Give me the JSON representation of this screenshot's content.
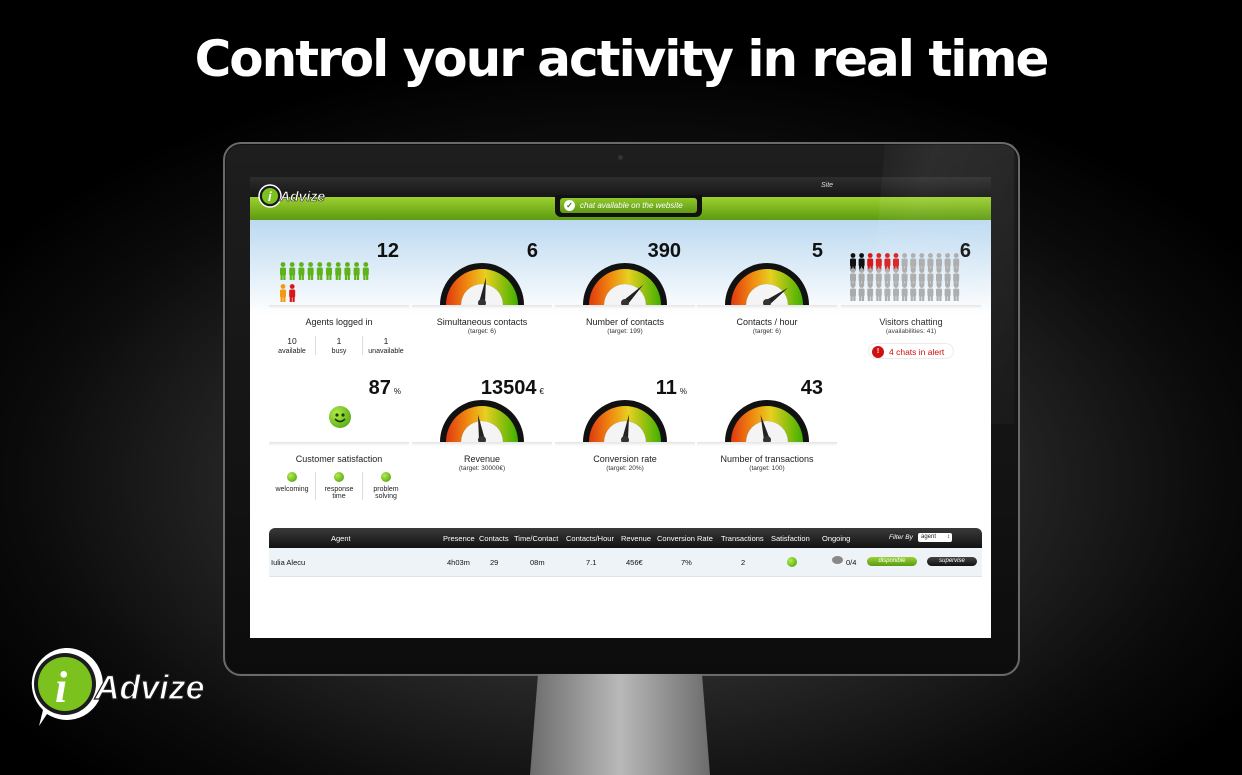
{
  "headline": "Control your activity in real time",
  "brand": {
    "name": "iAdvize",
    "green": "#7cc21e",
    "dark": "#1a1a1a"
  },
  "app": {
    "header_site_label": "Site",
    "chat_status": "chat available on the website"
  },
  "widgets_row1": [
    {
      "id": "agents",
      "value": "12",
      "title": "Agents logged in",
      "stats": [
        {
          "n": "10",
          "label": "available"
        },
        {
          "n": "1",
          "label": "busy"
        },
        {
          "n": "1",
          "label": "unavailable"
        }
      ]
    },
    {
      "id": "simultaneous",
      "value": "6",
      "title": "Simultaneous contacts",
      "sub": "(target: 6)",
      "level": 0.55
    },
    {
      "id": "contacts",
      "value": "390",
      "title": "Number of contacts",
      "sub": "(target: 199)",
      "level": 0.75
    },
    {
      "id": "per_hour",
      "value": "5",
      "title": "Contacts / hour",
      "sub": "(target: 6)",
      "level": 0.8
    },
    {
      "id": "visitors",
      "value": "6",
      "title": "Visitors chatting",
      "sub": "(availabilities: 41)",
      "alert": "4 chats in alert"
    }
  ],
  "widgets_row2": [
    {
      "id": "satisfaction",
      "value": "87",
      "unit": "%",
      "title": "Customer satisfaction",
      "stats": [
        {
          "label": "welcoming"
        },
        {
          "label": "response time"
        },
        {
          "label": "problem solving"
        }
      ]
    },
    {
      "id": "revenue",
      "value": "13504",
      "unit": "€",
      "title": "Revenue",
      "sub": "(target: 30000€)",
      "level": 0.45
    },
    {
      "id": "conversion",
      "value": "11",
      "unit": "%",
      "title": "Conversion rate",
      "sub": "(target: 20%)",
      "level": 0.55
    },
    {
      "id": "transactions",
      "value": "43",
      "title": "Number of transactions",
      "sub": "(target: 100)",
      "level": 0.42
    }
  ],
  "table": {
    "headers": [
      "Agent",
      "Presence",
      "Contacts",
      "Time/Contact",
      "Contacts/Hour",
      "Revenue",
      "Conversion Rate",
      "Transactions",
      "Satisfaction",
      "Ongoing"
    ],
    "filter_label": "Filter By",
    "filter_value": "agent",
    "rows": [
      {
        "agent": "Iulia Alecu",
        "presence": "4h03m",
        "contacts": "29",
        "time_contact": "08m",
        "contacts_hour": "7.1",
        "revenue": "456€",
        "conversion": "7%",
        "transactions": "2",
        "ongoing": "0/4",
        "status": "disponible",
        "action": "supervise"
      }
    ]
  },
  "icons": [
    "agent-figure-icon",
    "gauge-icon",
    "smiley-icon",
    "alert-icon",
    "check-icon",
    "chat-bubble-icon"
  ]
}
